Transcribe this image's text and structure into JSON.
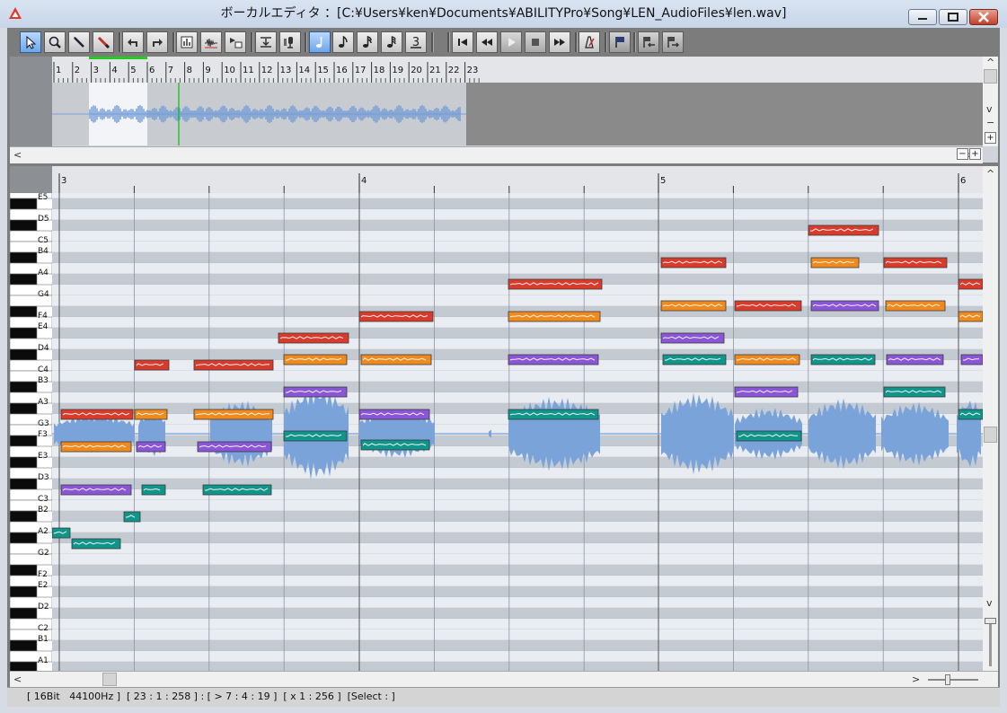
{
  "window": {
    "title": "ボーカルエディタ ：[C:¥Users¥ken¥Documents¥ABILITYPro¥Song¥LEN_AudioFiles¥len.wav]"
  },
  "toolbar": {
    "tools": [
      "select-arrow-icon",
      "zoom-icon",
      "pencil-icon",
      "eraser-icon",
      "undo-icon",
      "redo-icon",
      "bar-graph-icon",
      "waveform-icon",
      "grid-snap-icon",
      "quantize-icon",
      "mic-settings-icon",
      "quarter-note-icon",
      "eighth-note-icon",
      "sixteenth-note-icon",
      "thirty-second-note-icon",
      "triplet-icon",
      "rewind-to-start-icon",
      "rewind-icon",
      "play-icon",
      "stop-icon",
      "fast-forward-icon",
      "metronome-icon",
      "marker-flag-icon",
      "marker-prev-icon",
      "marker-next-icon"
    ],
    "triplet_label": "3",
    "accent": "#2f6fd6"
  },
  "overview": {
    "measures": [
      "1",
      "2",
      "3",
      "4",
      "5",
      "6",
      "7",
      "8",
      "9",
      "10",
      "11",
      "12",
      "13",
      "14",
      "15",
      "16",
      "17",
      "18",
      "19",
      "20",
      "21",
      "22",
      "23"
    ]
  },
  "editor": {
    "measures": [
      "3",
      "4",
      "5",
      "6"
    ],
    "key_labels": [
      "E5",
      "D5",
      "C5",
      "B4",
      "A4",
      "G4",
      "F4",
      "E4",
      "D4",
      "C4",
      "B3",
      "A3",
      "G3",
      "F3",
      "E3",
      "D3",
      "C3",
      "B2",
      "A2",
      "G2",
      "F2",
      "E2",
      "D2",
      "C2",
      "B1",
      "A1"
    ],
    "lane_colors": {
      "lead": "#d93a2a",
      "harmony_orange": "#f08a1c",
      "harmony_purple": "#8a55d6",
      "harmony_teal": "#10958a"
    }
  },
  "status": {
    "text": "[ 16Bit   44100Hz ]  [ 23 : 1 : 258 ] : [ > 7 : 4 : 19 ]  [ x 1 : 256 ]  [Select : ]"
  }
}
